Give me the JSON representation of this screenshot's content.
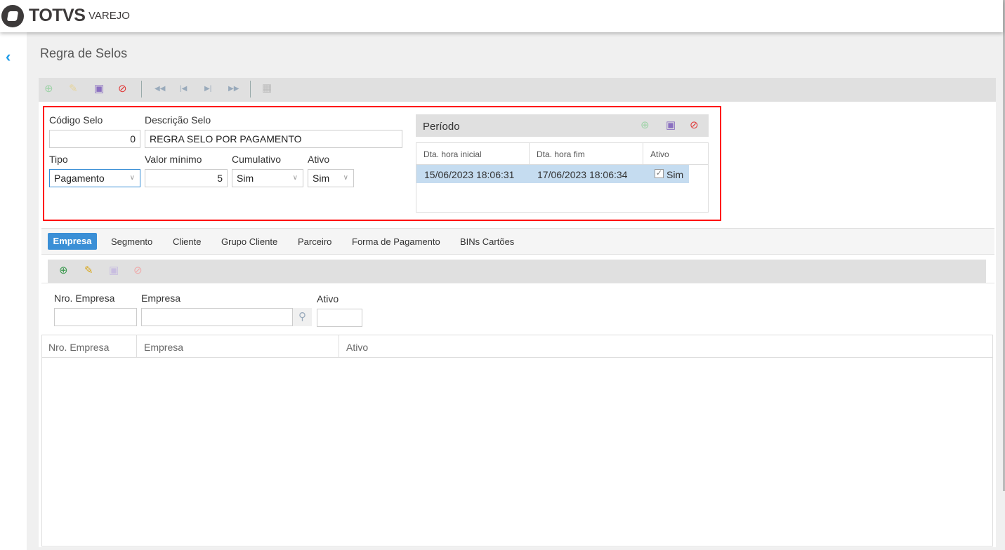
{
  "header": {
    "brand": "TOTVS",
    "product": "VAREJO"
  },
  "page": {
    "title": "Regra de Selos"
  },
  "form": {
    "codigo_label": "Código Selo",
    "codigo_value": "0",
    "descricao_label": "Descrição Selo",
    "descricao_value": "REGRA SELO POR PAGAMENTO",
    "tipo_label": "Tipo",
    "tipo_value": "Pagamento",
    "valor_label": "Valor mínimo",
    "valor_value": "5",
    "cumulativo_label": "Cumulativo",
    "cumulativo_value": "Sim",
    "ativo_label": "Ativo",
    "ativo_value": "Sim"
  },
  "periodo": {
    "title": "Período",
    "columns": [
      "Dta. hora inicial",
      "Dta. hora fim",
      "Ativo"
    ],
    "rows": [
      {
        "inicio": "15/06/2023 18:06:31",
        "fim": "17/06/2023 18:06:34",
        "ativo": "Sim"
      }
    ]
  },
  "tabs": [
    "Empresa",
    "Segmento",
    "Cliente",
    "Grupo Cliente",
    "Parceiro",
    "Forma de Pagamento",
    "BINs Cartões"
  ],
  "empresa_form": {
    "nro_label": "Nro. Empresa",
    "empresa_label": "Empresa",
    "ativo_label": "Ativo"
  },
  "grid": {
    "columns": [
      "Nro. Empresa",
      "Empresa",
      "Ativo"
    ]
  },
  "colors": {
    "accent": "#3a8fd6",
    "highlight": "#c5dcf0",
    "red_box": "#ff0000"
  }
}
